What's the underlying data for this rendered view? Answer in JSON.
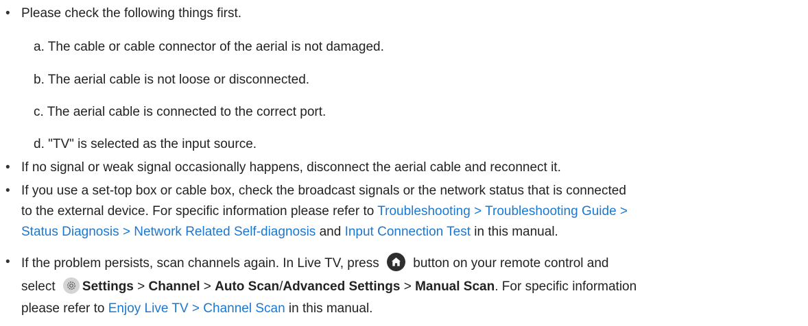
{
  "bullets": {
    "b1": {
      "text": "Please check the following things first.",
      "subs": [
        "a. The cable or cable connector of the aerial is not damaged.",
        "b. The aerial cable is not loose or disconnected.",
        "c. The aerial cable is connected to the correct port.",
        "d. \"TV\" is selected as the input source."
      ]
    },
    "b2": {
      "text": "If no signal or weak signal occasionally happens, disconnect the aerial cable and reconnect it."
    },
    "b3": {
      "line1": "If you use a set-top box or cable box, check the broadcast signals or the network status that is connected",
      "line2_pre": "to the external device. For specific information please refer to ",
      "link1_line2": "Troubleshooting > Troubleshooting Guide >",
      "link1_line3": "Status Diagnosis > Network Related Self-diagnosis",
      "and": " and ",
      "link2": "Input Connection Test",
      "line3_post": " in this manual."
    },
    "b4": {
      "line1_pre": "If the problem persists, scan channels again. In Live TV, press ",
      "line1_post": " button on your remote control and",
      "line2_select": "select ",
      "settings": "Settings",
      "sep": " > ",
      "channel": "Channel",
      "auto_scan": "Auto Scan",
      "slash": "/",
      "advanced": "Advanced Settings",
      "manual_scan": "Manual Scan",
      "line2_post": ". For specific information",
      "line3_pre": "please refer to ",
      "link": "Enjoy Live TV > Channel Scan",
      "line3_post": " in this manual."
    }
  },
  "bullet_char": "•",
  "icons": {
    "home": "home-icon",
    "settings": "gear-icon"
  },
  "colors": {
    "text": "#222222",
    "link": "#1b78d0",
    "home_icon_bg": "#2f2f2f",
    "settings_icon_bg": "#d4d4d4"
  }
}
